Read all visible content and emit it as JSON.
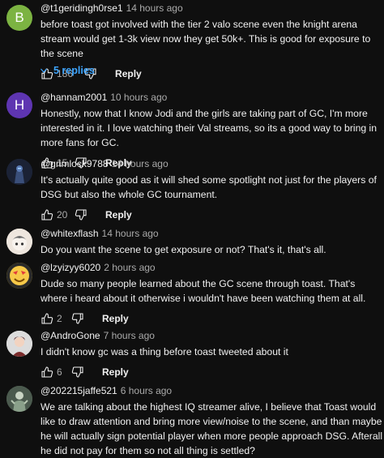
{
  "comments": [
    {
      "author": "@t1geridingh0rse1",
      "time": "14 hours ago",
      "avatar_letter": "B",
      "avatar_color": "#7cb342",
      "text": "before toast got involved with the tier 2 valo scene even the knight arena stream would get 1-3k view now they get 50k+. This is good for exposure to the scene",
      "likes": "186",
      "reply_label": "Reply",
      "replies_label": "5 replies"
    },
    {
      "author": "@hannam2001",
      "time": "10 hours ago",
      "avatar_letter": "H",
      "avatar_color": "#5e35b1",
      "text": "Honestly, now that I know Jodi and the girls are taking part of GC, I'm more interested in it. I love watching their Val streams, so its a good way to bring in more fans for GC.",
      "likes": "15",
      "reply_label": "Reply"
    },
    {
      "author": "@grimlock9788",
      "time": "14 hours ago",
      "avatar_icon": "robot-avatar-icon",
      "avatar_color": "#1e2a44",
      "text": "It's actually quite good as it will shed some spotlight not just for the players of DSG but also the whole GC tournament.",
      "likes": "20",
      "reply_label": "Reply"
    },
    {
      "author": "@whitexflash",
      "time": "14 hours ago",
      "avatar_icon": "anime-avatar-icon",
      "avatar_color": "#e8e0d8",
      "text": "Do you want the scene to get exposure or not? That's it, that's all.",
      "likes": "",
      "reply_label": "Reply"
    },
    {
      "author": "@lzyizyy6020",
      "time": "2 hours ago",
      "avatar_icon": "emoji-avatar-icon",
      "avatar_color": "#f4c20d",
      "text": "Dude so many people learned about the GC scene through toast. That's where i heard about it otherwise i wouldn't have been watching them at all.",
      "likes": "2",
      "reply_label": "Reply"
    },
    {
      "author": "@AndroGone",
      "time": "7 hours ago",
      "avatar_icon": "character-avatar-icon",
      "avatar_color": "#d6d6d6",
      "text": "I didn't know gc was a thing before toast tweeted about it",
      "likes": "6",
      "reply_label": "Reply"
    },
    {
      "author": "@202215jaffe521",
      "time": "6 hours ago",
      "avatar_icon": "figure-avatar-icon",
      "avatar_color": "#5d6b5a",
      "text": "We are talking about the highest IQ streamer alive, I believe that Toast would like to draw attention and bring more view/noise to the scene, and than maybe he will actually sign potential player when more people approach DSG. Afterall he did not pay for them so not all thing is settled?",
      "likes": "",
      "reply_label": ""
    }
  ]
}
